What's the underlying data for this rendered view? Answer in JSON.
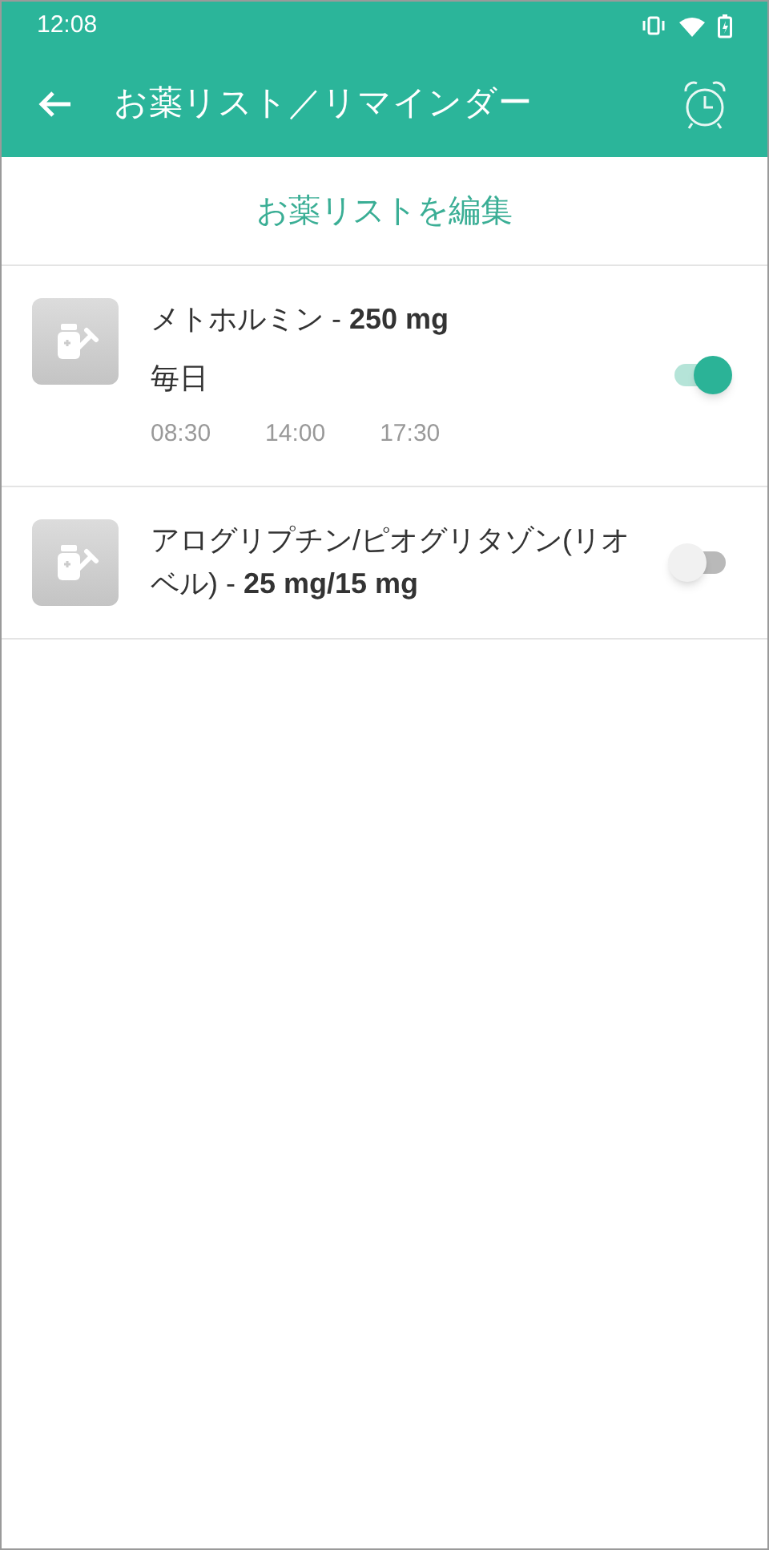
{
  "status_bar": {
    "time": "12:08"
  },
  "app_bar": {
    "title": "お薬リスト／リマインダー"
  },
  "edit_link": "お薬リストを編集",
  "medications": [
    {
      "name": "メトホルミン - **250 mg**",
      "on": true,
      "frequency": "毎日",
      "times": [
        "08:30",
        "14:00",
        "17:30"
      ]
    },
    {
      "name": "アログリプチン/ピオグリタゾン(リオベル) - **25 mg/15 mg**",
      "on": false
    }
  ]
}
